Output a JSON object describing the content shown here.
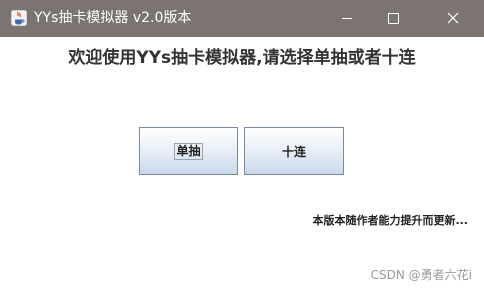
{
  "window": {
    "title": "YYs抽卡模拟器 v2.0版本",
    "titlebar_color": "#7b7470",
    "controls": {
      "minimize_icon": "minimize-icon",
      "maximize_icon": "maximize-icon",
      "close_icon": "close-icon"
    }
  },
  "main": {
    "heading": "欢迎使用YYs抽卡模拟器,请选择单抽或者十连",
    "single_draw_label": "单抽",
    "ten_draw_label": "十连",
    "version_note": "本版本随作者能力提升而更新..."
  },
  "watermark": "CSDN @勇者六花i"
}
